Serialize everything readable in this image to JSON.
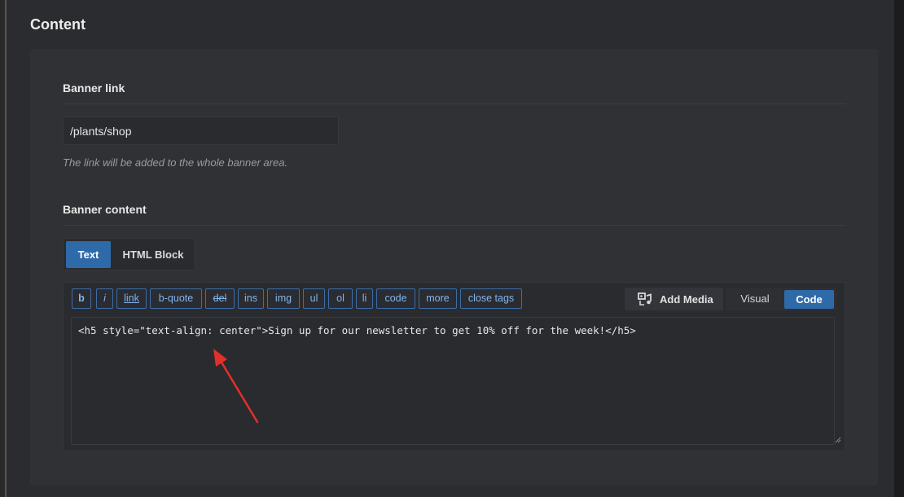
{
  "section": {
    "title": "Content"
  },
  "banner_link": {
    "label": "Banner link",
    "value": "/plants/shop",
    "hint": "The link will be added to the whole banner area."
  },
  "banner_content": {
    "label": "Banner content",
    "tabs": [
      {
        "label": "Text",
        "active": true
      },
      {
        "label": "HTML Block",
        "active": false
      }
    ],
    "quicktags": [
      "b",
      "i",
      "link",
      "b-quote",
      "del",
      "ins",
      "img",
      "ul",
      "ol",
      "li",
      "code",
      "more",
      "close tags"
    ],
    "add_media_label": "Add Media",
    "mode_visual": "Visual",
    "mode_code": "Code",
    "mode_active": "Code",
    "code_value": "<h5 style=\"text-align: center\">Sign up for our newsletter to get 10% off for the week!</h5>"
  },
  "icons": {
    "add_media": "media-icon",
    "resize": "resize-grip-icon",
    "annotation": "red-arrow-annotation"
  },
  "colors": {
    "accent": "#2f6aa8",
    "quicktag_text": "#82b4ec",
    "annotation": "#e0312a"
  }
}
